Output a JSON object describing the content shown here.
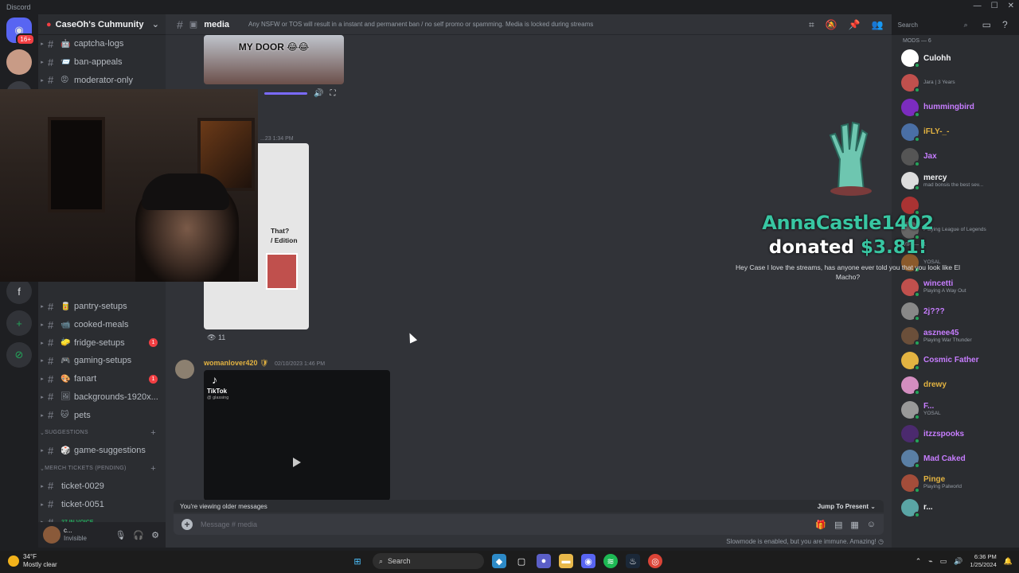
{
  "window": {
    "title": "Discord"
  },
  "servers": {
    "home_badge": "16+",
    "items": [
      "home",
      "avatar",
      "f",
      "add",
      "explore"
    ]
  },
  "guild": {
    "name": "CaseOh's Cuhmunity"
  },
  "channels": {
    "top": [
      {
        "label": "captcha-logs",
        "emoji": "🤖"
      },
      {
        "label": "ban-appeals",
        "emoji": "📨"
      },
      {
        "label": "moderator-only",
        "emoji": "😡"
      }
    ],
    "mid": [
      {
        "label": "pantry-setups",
        "emoji": "🥫",
        "unread": ""
      },
      {
        "label": "cooked-meals",
        "emoji": "📹",
        "unread": ""
      },
      {
        "label": "fridge-setups",
        "emoji": "🧽",
        "unread": "1"
      },
      {
        "label": "gaming-setups",
        "emoji": "🎮",
        "unread": ""
      },
      {
        "label": "fanart",
        "emoji": "🎨",
        "unread": "1"
      },
      {
        "label": "backgrounds-1920x...",
        "emoji": "🖼",
        "unread": ""
      },
      {
        "label": "pets",
        "emoji": "🐱",
        "unread": ""
      }
    ],
    "cat_suggestions": "Suggestions",
    "suggestions": [
      {
        "label": "game-suggestions",
        "emoji": "🎲"
      }
    ],
    "cat_merch": "Merch Tickets (Pending)",
    "merch": [
      {
        "label": "ticket-0029"
      },
      {
        "label": "ticket-0051"
      }
    ],
    "voice": "27 IN VOICE"
  },
  "user": {
    "name": "c...",
    "status": "Invisible"
  },
  "channel_header": {
    "name": "media",
    "topic": "Any NSFW or TOS will result in a instant and permanent ban / no self promo or spamming. Media is locked during streams"
  },
  "toolbar": {
    "search_placeholder": "Search"
  },
  "messages": [
    {
      "image_caption": "MY DOOR 😂😂",
      "timestamp": "...23 1:34 PM",
      "card_text": "That?\n/ Edition",
      "views": "11"
    },
    {
      "author": "womanlover420",
      "timestamp": "02/10/2023 1:46 PM",
      "video_brand": "TikTok",
      "video_user": "@ glassing"
    }
  ],
  "older_bar": {
    "text": "You're viewing older messages",
    "jump": "Jump To Present"
  },
  "composer": {
    "placeholder": "Message #  media"
  },
  "slowmode": "Slowmode is enabled, but you are immune. Amazing!",
  "donation": {
    "donor": "AnnaCastle1402",
    "donated_word": "donated",
    "amount": "$3.81!",
    "message": "Hey Case I love the streams, has anyone ever told you that you look like El Macho?"
  },
  "members": {
    "group_mods": "MODS — 6",
    "group_vip": "VIP — 11",
    "list": [
      {
        "name": "Culohh",
        "sub": "",
        "color": "#f2f3f5",
        "av": "#ffffff"
      },
      {
        "name": "",
        "sub": "Jara | 3 Years",
        "color": "#f2f3f5",
        "av": "#c0504d"
      },
      {
        "name": "hummingbird",
        "sub": "",
        "color": "#c77dff",
        "av": "#7b2cbf"
      },
      {
        "name": "iFLY-_-",
        "sub": "",
        "color": "#e3b341",
        "av": "#4a6fa5"
      },
      {
        "name": "Jax",
        "sub": "",
        "color": "#c77dff",
        "av": "#555"
      },
      {
        "name": "mercy",
        "sub": "mad bonsis the best sev...",
        "color": "#f2f3f5",
        "av": "#ddd"
      },
      {
        "name": "",
        "sub": "",
        "color": "#f23f43",
        "av": "#a33"
      },
      {
        "name": "",
        "sub": "Playing League of Legends",
        "color": "#f2f3f5",
        "av": "#666"
      },
      {
        "name": "",
        "sub": "YOSAL",
        "color": "#c77dff",
        "av": "#8b5a2b"
      },
      {
        "name": "wincetti",
        "sub": "Playing A Way Out",
        "color": "#c77dff",
        "av": "#c0504d"
      },
      {
        "name": "2j???",
        "sub": "",
        "color": "#c77dff",
        "av": "#888"
      },
      {
        "name": "asznee45",
        "sub": "Playing War Thunder",
        "color": "#c77dff",
        "av": "#6b4f3a"
      },
      {
        "name": "Cosmic Father",
        "sub": "",
        "color": "#c77dff",
        "av": "#e3b341"
      },
      {
        "name": "drewy",
        "sub": "",
        "color": "#e3b341",
        "av": "#d48ec0"
      },
      {
        "name": "F...",
        "sub": "YOSAL",
        "color": "#c77dff",
        "av": "#999"
      },
      {
        "name": "itzzspooks",
        "sub": "",
        "color": "#c77dff",
        "av": "#4b2a6e"
      },
      {
        "name": "Mad Caked",
        "sub": "",
        "color": "#c77dff",
        "av": "#5a7fa5"
      },
      {
        "name": "Pinge",
        "sub": "Playing Palworld",
        "color": "#e3b341",
        "av": "#a34d3a"
      },
      {
        "name": "r...",
        "sub": "",
        "color": "#f2f3f5",
        "av": "#5aa5a5"
      }
    ]
  },
  "taskbar": {
    "weather_temp": "34°F",
    "weather_desc": "Mostly clear",
    "search": "Search",
    "time": "6:36 PM",
    "date": "1/25/2024"
  }
}
